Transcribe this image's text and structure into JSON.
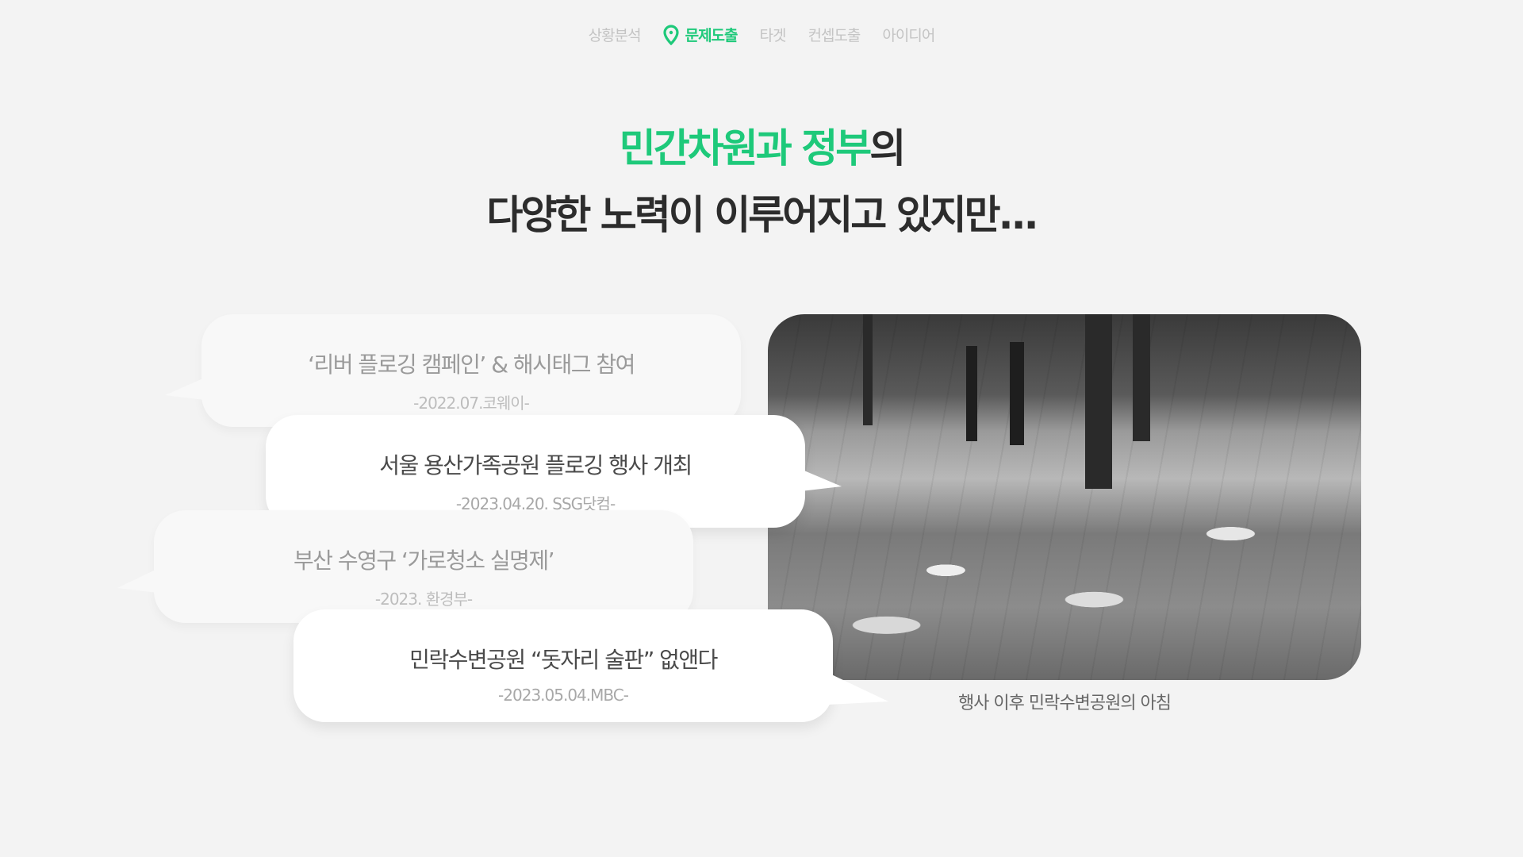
{
  "nav": {
    "items": [
      {
        "label": "상황분석",
        "active": false
      },
      {
        "label": "문제도출",
        "active": true,
        "icon": "map-pin-icon"
      },
      {
        "label": "타겟",
        "active": false
      },
      {
        "label": "컨셉도출",
        "active": false
      },
      {
        "label": "아이디어",
        "active": false
      }
    ]
  },
  "title": {
    "line1_highlight": "민간차원과 정부",
    "line1_rest": "의",
    "line2": "다양한 노력이 이루어지고 있지만..."
  },
  "bubbles": [
    {
      "headline": "‘리버 플로깅 캠페인’ & 해시태그 참여",
      "source": "-2022.07.코웨이-"
    },
    {
      "headline": "서울 용산가족공원 플로깅 행사 개최",
      "source": "-2023.04.20. SSG닷컴-"
    },
    {
      "headline": "부산 수영구 ‘가로청소 실명제’",
      "source": "-2023. 환경부-"
    },
    {
      "headline": "민락수변공원 “돗자리 술판” 없앤다",
      "source": "-2023.05.04.MBC-"
    }
  ],
  "photo": {
    "caption": "행사 이후 민락수변공원의 아침"
  },
  "colors": {
    "accent": "#1ec97a",
    "text": "#2c2c2c",
    "background": "#f3f3f3"
  }
}
